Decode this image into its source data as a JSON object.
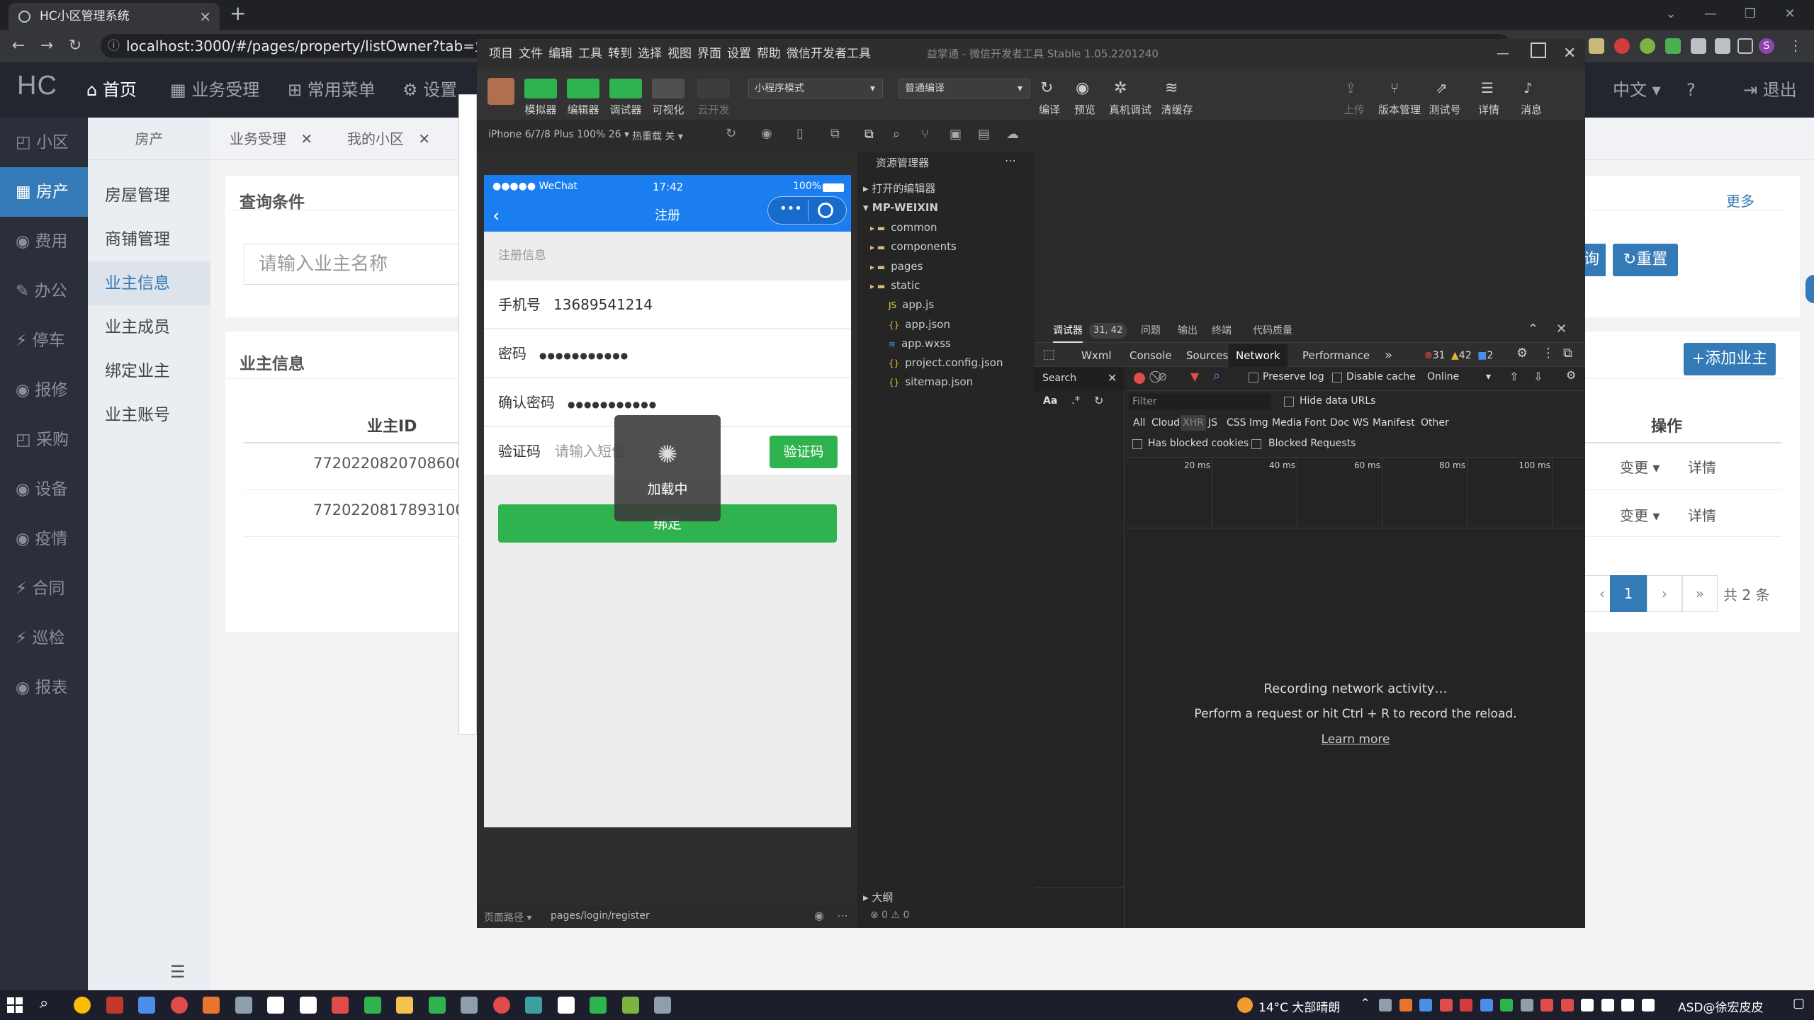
{
  "browser": {
    "tab_title": "HC小区管理系统",
    "url": "localhost:3000/#/pages/property/listOwner?tab=业主信息"
  },
  "hc": {
    "logo": "HC",
    "top_menu": [
      {
        "label": "首页",
        "icon": "home-icon"
      },
      {
        "label": "业务受理",
        "icon": "grid-icon"
      },
      {
        "label": "常用菜单",
        "icon": "sitemap-icon"
      },
      {
        "label": "设置",
        "icon": "gear-icon"
      }
    ],
    "right_menu": {
      "lang": "中文",
      "logout": "退出"
    },
    "sidebar": [
      "小区",
      "房产",
      "费用",
      "办公",
      "停车",
      "报修",
      "采购",
      "设备",
      "疫情",
      "合同",
      "巡检",
      "报表"
    ],
    "sidebar_active": "房产",
    "submenu": [
      "房屋管理",
      "商铺管理",
      "业主信息",
      "业主成员",
      "绑定业主",
      "业主账号"
    ],
    "submenu_active": "业主信息",
    "subheader": "房产",
    "tabs": [
      "业务受理",
      "我的小区"
    ],
    "query_title": "查询条件",
    "more": "更多",
    "search_placeholder": "请输入业主名称",
    "query_button": "询",
    "reset_button": "重置",
    "owner_title": "业主信息",
    "add_owner": "添加业主",
    "table_headers": {
      "id": "业主ID",
      "op": "操作"
    },
    "rows": [
      {
        "id": "772022082070860001",
        "change": "变更",
        "detail": "详情"
      },
      {
        "id": "772022081789310004",
        "change": "变更",
        "detail": "详情"
      }
    ],
    "pagination": {
      "prev": "‹",
      "page": "1",
      "next": "›",
      "last": "»",
      "total": "共 2 条"
    }
  },
  "wx": {
    "menu": [
      "项目",
      "文件",
      "编辑",
      "工具",
      "转到",
      "选择",
      "视图",
      "界面",
      "设置",
      "帮助",
      "微信开发者工具"
    ],
    "title": "益掌通 - 微信开发者工具 Stable 1.05.2201240",
    "toolbar_left": [
      "模拟器",
      "编辑器",
      "调试器",
      "可视化",
      "云开发"
    ],
    "mode": "小程序模式",
    "compile": "普通编译",
    "toolbar_mid": [
      "编译",
      "预览",
      "真机调试",
      "清缓存"
    ],
    "toolbar_right": [
      "上传",
      "版本管理",
      "测试号",
      "详情",
      "消息"
    ],
    "device": "iPhone 6/7/8 Plus 100% 26 ▾",
    "hot_reload": "热重载 关 ▾",
    "phone": {
      "carrier": "●●●●● WeChat",
      "time": "17:42",
      "battery": "100%",
      "nav_title": "注册",
      "section": "注册信息",
      "phone_label": "手机号",
      "phone_value": "13689541214",
      "pwd_label": "密码",
      "pwd_value": "●●●●●●●●●●●",
      "confirm_label": "确认密码",
      "confirm_value": "●●●●●●●●●●●",
      "code_label": "验证码",
      "code_placeholder": "请输入短信",
      "code_button": "验证码",
      "submit": "绑定",
      "toast": "加载中"
    },
    "explorer": {
      "title": "资源管理器",
      "open_editors": "打开的编辑器",
      "root": "MP-WEIXIN",
      "items": [
        {
          "name": "common",
          "type": "folder"
        },
        {
          "name": "components",
          "type": "folder"
        },
        {
          "name": "pages",
          "type": "folder"
        },
        {
          "name": "static",
          "type": "folder"
        },
        {
          "name": "app.js",
          "type": "js"
        },
        {
          "name": "app.json",
          "type": "json"
        },
        {
          "name": "app.wxss",
          "type": "wxss"
        },
        {
          "name": "project.config.json",
          "type": "json"
        },
        {
          "name": "sitemap.json",
          "type": "json"
        }
      ],
      "outline": "大纲",
      "status": "⊗ 0 ⚠ 0"
    },
    "footer": {
      "path_label": "页面路径 ▾",
      "path": "pages/login/register"
    },
    "devtools": {
      "top_tabs": [
        "调试器",
        "问题",
        "输出",
        "终端",
        "代码质量"
      ],
      "badge": "31, 42",
      "tabs": [
        "Wxml",
        "Console",
        "Sources",
        "Network",
        "Performance"
      ],
      "active": "Network",
      "errors": "31",
      "warnings": "42",
      "info": "2",
      "search": "Search",
      "preserve_log": "Preserve log",
      "disable_cache": "Disable cache",
      "online": "Online",
      "filter_placeholder": "Filter",
      "hide_data_urls": "Hide data URLs",
      "types": [
        "All",
        "Cloud",
        "XHR",
        "JS",
        "CSS",
        "Img",
        "Media",
        "Font",
        "Doc",
        "WS",
        "Manifest",
        "Other"
      ],
      "blocked_cookies": "Has blocked cookies",
      "blocked_requests": "Blocked Requests",
      "timeline": [
        "20 ms",
        "40 ms",
        "60 ms",
        "80 ms",
        "100 ms"
      ],
      "recording": "Recording network activity…",
      "hint": "Perform a request or hit Ctrl + R to record the reload.",
      "learn_more": "Learn more",
      "aa": "Aa"
    }
  },
  "taskbar": {
    "weather": "14°C 大部晴朗",
    "right_text": "ASD@徐宏皮皮"
  }
}
